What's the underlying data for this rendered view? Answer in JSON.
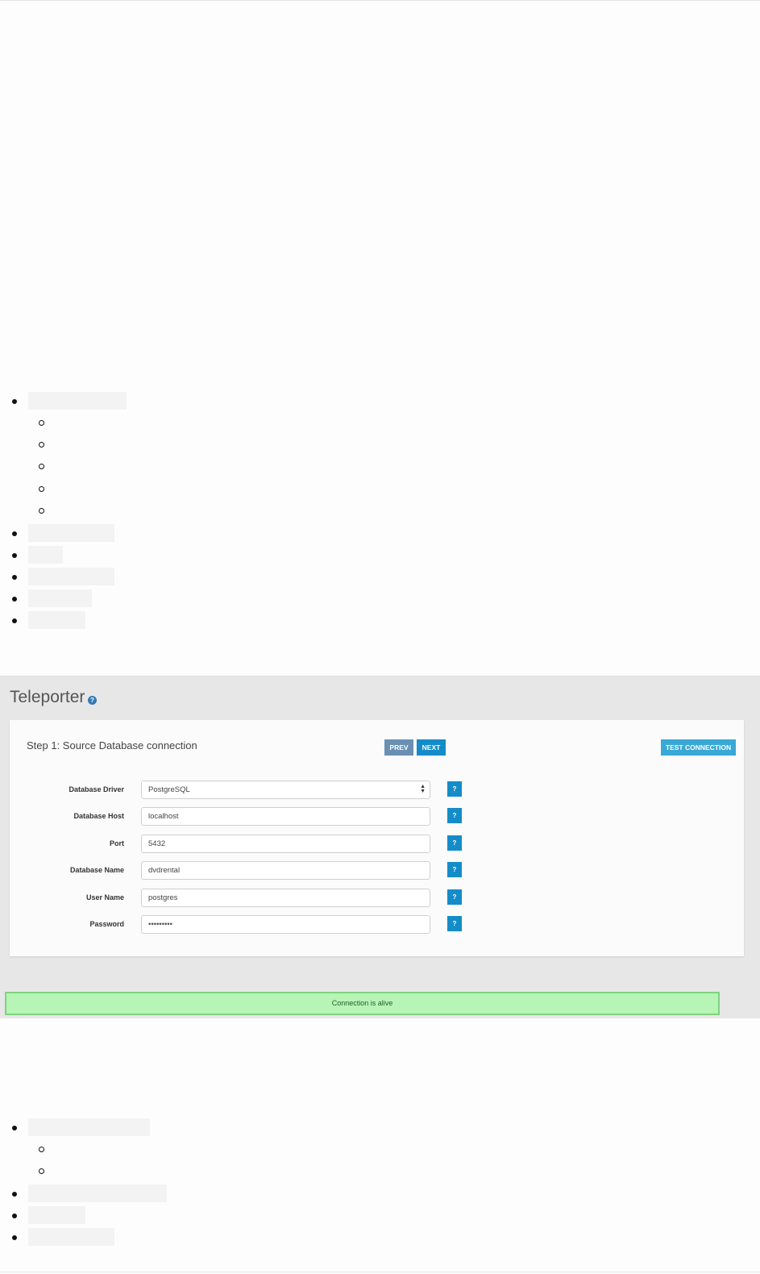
{
  "panel": {
    "title": "Teleporter",
    "help_icon_glyph": "?"
  },
  "wizard": {
    "step_title": "Step 1: Source Database connection",
    "prev_label": "PREV",
    "next_label": "NEXT",
    "test_connection_label": "TEST CONNECTION"
  },
  "form": {
    "driver_label": "Database Driver",
    "driver_value": "PostgreSQL",
    "host_label": "Database Host",
    "host_value": "localhost",
    "port_label": "Port",
    "port_value": "5432",
    "dbname_label": "Database Name",
    "dbname_value": "dvdrental",
    "user_label": "User Name",
    "user_value": "postgres",
    "password_label": "Password",
    "password_value": "•••••••••",
    "help_label": "?"
  },
  "status": {
    "message": "Connection is alive",
    "color": "#b6f5b6"
  },
  "icons": {
    "title_help": "question-circle-icon",
    "select_arrows": "updown-arrows-icon"
  }
}
